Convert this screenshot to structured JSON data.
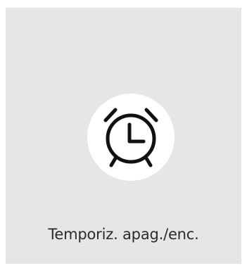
{
  "tile": {
    "label": "Temporiz. apag./enc.",
    "icon": "alarm-clock-icon",
    "background_color": "#e6e6e6",
    "icon_background_color": "#ffffff",
    "icon_color": "#111111"
  }
}
